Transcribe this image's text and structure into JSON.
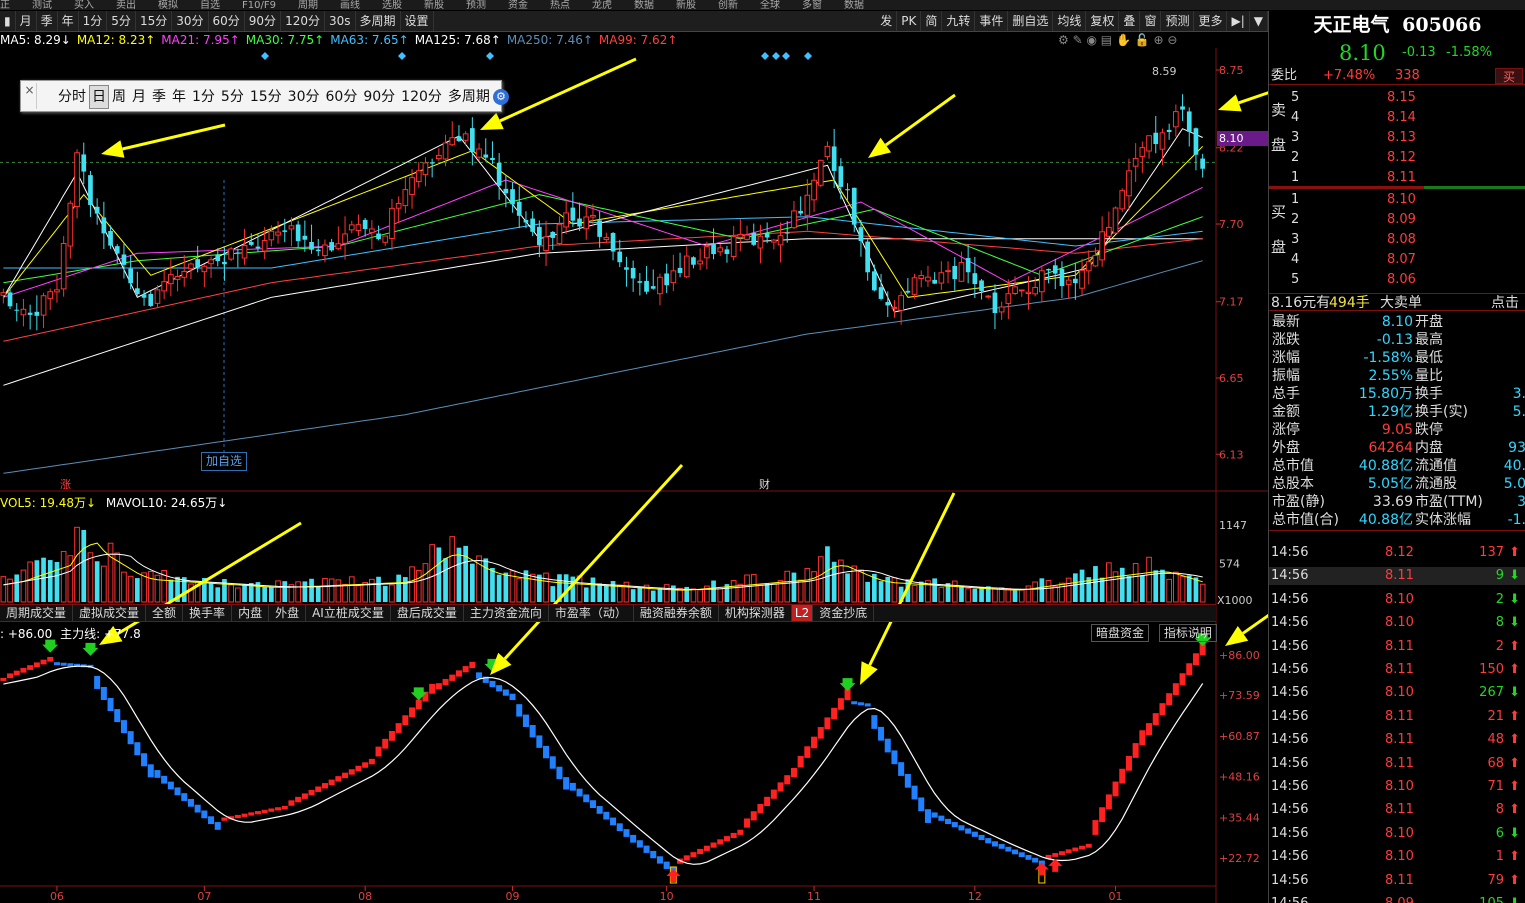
{
  "top_menu": [
    "正",
    "测试",
    "买入",
    "卖出",
    "模拟",
    "自选",
    "F10/F9",
    "周期",
    "画线",
    "选股",
    "新股",
    "预测",
    "资金",
    "热点",
    "龙虎",
    "数据",
    "新股",
    "创新",
    "全球",
    "多窗",
    "数据"
  ],
  "toolbar": {
    "periods": [
      "月",
      "季",
      "年",
      "1分",
      "5分",
      "15分",
      "30分",
      "60分",
      "90分",
      "120分",
      "30s",
      "多周期",
      "设置"
    ],
    "right_items": [
      "发",
      "PK",
      "简",
      "九转",
      "事件",
      "删自选",
      "均线",
      "复权",
      "叠",
      "窗",
      "预测",
      "更多"
    ]
  },
  "ma_legend": [
    {
      "label": "MA5: 8.29↓",
      "color": "#ffffff"
    },
    {
      "label": "MA12: 8.23↑",
      "color": "#ffff00"
    },
    {
      "label": "MA21: 7.95↑",
      "color": "#ff40ff"
    },
    {
      "label": "MA30: 7.75↑",
      "color": "#40ff40"
    },
    {
      "label": "MA63: 7.65↑",
      "color": "#40c0ff"
    },
    {
      "label": "MA125: 7.68↑",
      "color": "#ffffff"
    },
    {
      "label": "MA250: 7.46↑",
      "color": "#5a8fb8"
    },
    {
      "label": "MA99: 7.62↑",
      "color": "#ff4040"
    }
  ],
  "period_popup": {
    "items": [
      "分时",
      "日",
      "周",
      "月",
      "季",
      "年",
      "1分",
      "5分",
      "15分",
      "30分",
      "60分",
      "90分",
      "120分",
      "多周期"
    ],
    "selected": "日",
    "close_symbol": "×"
  },
  "price_axis": [
    "8.75",
    "8.22",
    "7.70",
    "7.17",
    "6.65",
    "6.13"
  ],
  "current_price_tag": "8.10",
  "high_marker": "8.59",
  "add_favorite_tag": "加自选",
  "event_markers": [
    {
      "text": "涨"
    },
    {
      "text": "财"
    }
  ],
  "volume_legend": {
    "vol5": "VOL5: 19.48万↓",
    "mavol10": "MAVOL10: 24.65万↓"
  },
  "volume_axis": [
    "1147",
    "574",
    "X1000"
  ],
  "indicator_tabs": [
    "周期成交量",
    "虚拟成交量",
    "全额",
    "换手率",
    "内盘",
    "外盘",
    "AI立桩成交量",
    "盘后成交量",
    "主力资金流向",
    "市盈率（动）",
    "融资融券余额",
    "机构探测器",
    "L2",
    "资金抄底"
  ],
  "indicator_legend": {
    "value": ": +86.00",
    "mainline": "主力线: +77.8"
  },
  "indicator_buttons": [
    "暗盘资金",
    "指标说明"
  ],
  "indicator_axis": [
    "+86.00",
    "+73.59",
    "+60.87",
    "+48.16",
    "+35.44",
    "+22.72"
  ],
  "date_axis": [
    "06",
    "07",
    "08",
    "09",
    "10",
    "11",
    "12",
    "01"
  ],
  "quote": {
    "name": "天正电气",
    "code": "605066",
    "price": "8.10",
    "change": "-0.13",
    "change_pct": "-1.58%",
    "commission_label": "委比",
    "commission_ratio": "+7.48%",
    "commission_diff": "338",
    "sell_button": "买",
    "sell_side_label": "卖盘",
    "buy_side_label": "买盘",
    "asks": [
      {
        "level": "5",
        "price": "8.15",
        "vol": ""
      },
      {
        "level": "4",
        "price": "8.14",
        "vol": ""
      },
      {
        "level": "3",
        "price": "8.13",
        "vol": ""
      },
      {
        "level": "2",
        "price": "8.12",
        "vol": ""
      },
      {
        "level": "1",
        "price": "8.11",
        "vol": ""
      }
    ],
    "bids": [
      {
        "level": "1",
        "price": "8.10",
        "vol": ""
      },
      {
        "level": "2",
        "price": "8.09",
        "vol": ""
      },
      {
        "level": "3",
        "price": "8.08",
        "vol": ""
      },
      {
        "level": "4",
        "price": "8.07",
        "vol": ""
      },
      {
        "level": "5",
        "price": "8.06",
        "vol": ""
      }
    ],
    "big_order": {
      "price": "8.16元有",
      "hands": "494手",
      "label": "大卖单",
      "link": "点击"
    },
    "stats": [
      {
        "k": "最新",
        "v": "8.10",
        "vc": "cyan",
        "k2": "开盘",
        "v2": ""
      },
      {
        "k": "涨跌",
        "v": "-0.13",
        "vc": "cyan",
        "k2": "最高",
        "v2": ""
      },
      {
        "k": "涨幅",
        "v": "-1.58%",
        "vc": "cyan",
        "k2": "最低",
        "v2": ""
      },
      {
        "k": "振幅",
        "v": "2.55%",
        "vc": "cyan",
        "k2": "量比",
        "v2": ""
      },
      {
        "k": "总手",
        "v": "15.80万",
        "vc": "cyan",
        "k2": "换手",
        "v2": "3."
      },
      {
        "k": "金额",
        "v": "1.29亿",
        "vc": "cyan",
        "k2": "换手(实)",
        "v2": "5."
      },
      {
        "k": "涨停",
        "v": "9.05",
        "vc": "red",
        "k2": "跌停",
        "v2": ""
      },
      {
        "k": "外盘",
        "v": "64264",
        "vc": "red",
        "k2": "内盘",
        "v2": "93"
      },
      {
        "k": "总市值",
        "v": "40.88亿",
        "vc": "cyan",
        "k2": "流通值",
        "v2": "40."
      },
      {
        "k": "总股本",
        "v": "5.05亿",
        "vc": "cyan",
        "k2": "流通股",
        "v2": "5.0"
      },
      {
        "k": "市盈(静)",
        "v": "33.69",
        "vc": "white",
        "k2": "市盈(TTM)",
        "v2": "3"
      },
      {
        "k": "总市值(合)",
        "v": "40.88亿",
        "vc": "cyan",
        "k2": "实体涨幅",
        "v2": "-1."
      }
    ],
    "ticks": [
      {
        "t": "14:56",
        "p": "8.12",
        "v": "137",
        "d": "up"
      },
      {
        "t": "14:56",
        "p": "8.11",
        "v": "9",
        "d": "down"
      },
      {
        "t": "14:56",
        "p": "8.10",
        "v": "2",
        "d": "down"
      },
      {
        "t": "14:56",
        "p": "8.10",
        "v": "8",
        "d": "down"
      },
      {
        "t": "14:56",
        "p": "8.11",
        "v": "2",
        "d": "up"
      },
      {
        "t": "14:56",
        "p": "8.11",
        "v": "150",
        "d": "up"
      },
      {
        "t": "14:56",
        "p": "8.10",
        "v": "267",
        "d": "down"
      },
      {
        "t": "14:56",
        "p": "8.11",
        "v": "21",
        "d": "up"
      },
      {
        "t": "14:56",
        "p": "8.11",
        "v": "48",
        "d": "up"
      },
      {
        "t": "14:56",
        "p": "8.11",
        "v": "68",
        "d": "up"
      },
      {
        "t": "14:56",
        "p": "8.10",
        "v": "71",
        "d": "up"
      },
      {
        "t": "14:56",
        "p": "8.11",
        "v": "8",
        "d": "up"
      },
      {
        "t": "14:56",
        "p": "8.10",
        "v": "6",
        "d": "down"
      },
      {
        "t": "14:56",
        "p": "8.10",
        "v": "1",
        "d": "up"
      },
      {
        "t": "14:56",
        "p": "8.11",
        "v": "79",
        "d": "up"
      },
      {
        "t": "14:56",
        "p": "8.09",
        "v": "105",
        "d": "down"
      }
    ]
  },
  "chart_data": [
    {
      "type": "candlestick",
      "title": "",
      "ylim": [
        5.9,
        8.9
      ],
      "x_ticks": [
        "06",
        "07",
        "08",
        "09",
        "10",
        "11",
        "12",
        "01"
      ],
      "price_anchors": [
        {
          "i": 0,
          "p": 7.2
        },
        {
          "i": 5,
          "p": 7.1
        },
        {
          "i": 8,
          "p": 7.3
        },
        {
          "i": 11,
          "p": 8.2
        },
        {
          "i": 13,
          "p": 7.85
        },
        {
          "i": 18,
          "p": 7.4
        },
        {
          "i": 22,
          "p": 7.15
        },
        {
          "i": 26,
          "p": 7.35
        },
        {
          "i": 30,
          "p": 7.45
        },
        {
          "i": 36,
          "p": 7.5
        },
        {
          "i": 42,
          "p": 7.65
        },
        {
          "i": 48,
          "p": 7.55
        },
        {
          "i": 52,
          "p": 7.65
        },
        {
          "i": 56,
          "p": 7.6
        },
        {
          "i": 60,
          "p": 7.9
        },
        {
          "i": 64,
          "p": 8.15
        },
        {
          "i": 68,
          "p": 8.3
        },
        {
          "i": 72,
          "p": 8.2
        },
        {
          "i": 76,
          "p": 7.8
        },
        {
          "i": 80,
          "p": 7.55
        },
        {
          "i": 84,
          "p": 7.75
        },
        {
          "i": 88,
          "p": 7.7
        },
        {
          "i": 92,
          "p": 7.45
        },
        {
          "i": 96,
          "p": 7.25
        },
        {
          "i": 100,
          "p": 7.35
        },
        {
          "i": 104,
          "p": 7.5
        },
        {
          "i": 108,
          "p": 7.55
        },
        {
          "i": 112,
          "p": 7.6
        },
        {
          "i": 116,
          "p": 7.62
        },
        {
          "i": 120,
          "p": 7.9
        },
        {
          "i": 123,
          "p": 8.2
        },
        {
          "i": 126,
          "p": 7.9
        },
        {
          "i": 129,
          "p": 7.4
        },
        {
          "i": 132,
          "p": 7.1
        },
        {
          "i": 136,
          "p": 7.3
        },
        {
          "i": 140,
          "p": 7.35
        },
        {
          "i": 144,
          "p": 7.4
        },
        {
          "i": 148,
          "p": 7.1
        },
        {
          "i": 152,
          "p": 7.25
        },
        {
          "i": 156,
          "p": 7.35
        },
        {
          "i": 160,
          "p": 7.3
        },
        {
          "i": 164,
          "p": 7.6
        },
        {
          "i": 168,
          "p": 8.1
        },
        {
          "i": 172,
          "p": 8.3
        },
        {
          "i": 176,
          "p": 8.45
        },
        {
          "i": 179,
          "p": 8.1
        }
      ],
      "ma_lines": [
        {
          "name": "MA125",
          "color": "#ffffff",
          "anchors": [
            {
              "i": 0,
              "p": 6.6
            },
            {
              "i": 40,
              "p": 7.2
            },
            {
              "i": 80,
              "p": 7.5
            },
            {
              "i": 120,
              "p": 7.6
            },
            {
              "i": 179,
              "p": 7.6
            }
          ]
        },
        {
          "name": "MA250",
          "color": "#5a8fb8",
          "anchors": [
            {
              "i": 0,
              "p": 6.0
            },
            {
              "i": 60,
              "p": 6.4
            },
            {
              "i": 120,
              "p": 6.95
            },
            {
              "i": 160,
              "p": 7.2
            },
            {
              "i": 179,
              "p": 7.45
            }
          ]
        },
        {
          "name": "MA99",
          "color": "#ff4040",
          "anchors": [
            {
              "i": 0,
              "p": 6.9
            },
            {
              "i": 40,
              "p": 7.3
            },
            {
              "i": 80,
              "p": 7.55
            },
            {
              "i": 120,
              "p": 7.65
            },
            {
              "i": 160,
              "p": 7.5
            },
            {
              "i": 179,
              "p": 7.6
            }
          ]
        },
        {
          "name": "MA63",
          "color": "#40c0ff",
          "anchors": [
            {
              "i": 0,
              "p": 7.4
            },
            {
              "i": 40,
              "p": 7.4
            },
            {
              "i": 80,
              "p": 7.7
            },
            {
              "i": 120,
              "p": 7.75
            },
            {
              "i": 160,
              "p": 7.55
            },
            {
              "i": 179,
              "p": 7.65
            }
          ]
        },
        {
          "name": "MA30",
          "color": "#40ff40",
          "anchors": [
            {
              "i": 0,
              "p": 7.3
            },
            {
              "i": 20,
              "p": 7.45
            },
            {
              "i": 50,
              "p": 7.55
            },
            {
              "i": 80,
              "p": 7.9
            },
            {
              "i": 110,
              "p": 7.6
            },
            {
              "i": 130,
              "p": 7.8
            },
            {
              "i": 155,
              "p": 7.35
            },
            {
              "i": 179,
              "p": 7.75
            }
          ]
        },
        {
          "name": "MA21",
          "color": "#ff40ff",
          "anchors": [
            {
              "i": 0,
              "p": 7.2
            },
            {
              "i": 20,
              "p": 7.5
            },
            {
              "i": 50,
              "p": 7.55
            },
            {
              "i": 75,
              "p": 8.0
            },
            {
              "i": 105,
              "p": 7.55
            },
            {
              "i": 128,
              "p": 7.85
            },
            {
              "i": 150,
              "p": 7.3
            },
            {
              "i": 179,
              "p": 7.95
            }
          ]
        },
        {
          "name": "MA12",
          "color": "#ffff00",
          "anchors": [
            {
              "i": 0,
              "p": 7.2
            },
            {
              "i": 12,
              "p": 7.9
            },
            {
              "i": 22,
              "p": 7.35
            },
            {
              "i": 70,
              "p": 8.2
            },
            {
              "i": 85,
              "p": 7.7
            },
            {
              "i": 124,
              "p": 8.0
            },
            {
              "i": 135,
              "p": 7.2
            },
            {
              "i": 160,
              "p": 7.35
            },
            {
              "i": 179,
              "p": 8.23
            }
          ]
        },
        {
          "name": "MA5",
          "color": "#ffffff",
          "anchors": [
            {
              "i": 0,
              "p": 7.2
            },
            {
              "i": 11,
              "p": 8.05
            },
            {
              "i": 20,
              "p": 7.2
            },
            {
              "i": 68,
              "p": 8.3
            },
            {
              "i": 80,
              "p": 7.6
            },
            {
              "i": 123,
              "p": 8.1
            },
            {
              "i": 133,
              "p": 7.1
            },
            {
              "i": 162,
              "p": 7.4
            },
            {
              "i": 176,
              "p": 8.35
            },
            {
              "i": 179,
              "p": 8.29
            }
          ]
        }
      ]
    },
    {
      "type": "bar",
      "title": "VOL",
      "ylim": [
        0,
        1400
      ],
      "volume_anchors": [
        {
          "i": 0,
          "v": 300
        },
        {
          "i": 10,
          "v": 700
        },
        {
          "i": 11,
          "v": 1300
        },
        {
          "i": 13,
          "v": 900
        },
        {
          "i": 20,
          "v": 400
        },
        {
          "i": 40,
          "v": 250
        },
        {
          "i": 60,
          "v": 350
        },
        {
          "i": 66,
          "v": 900
        },
        {
          "i": 72,
          "v": 500
        },
        {
          "i": 80,
          "v": 350
        },
        {
          "i": 100,
          "v": 200
        },
        {
          "i": 120,
          "v": 400
        },
        {
          "i": 123,
          "v": 700
        },
        {
          "i": 130,
          "v": 350
        },
        {
          "i": 150,
          "v": 200
        },
        {
          "i": 165,
          "v": 450
        },
        {
          "i": 172,
          "v": 550
        },
        {
          "i": 179,
          "v": 300
        }
      ]
    },
    {
      "type": "step",
      "title": "主力线",
      "ylim": [
        15,
        92
      ],
      "x_ticks": [
        "06",
        "07",
        "08",
        "09",
        "10",
        "11",
        "12",
        "01"
      ],
      "anchors": [
        {
          "i": 0,
          "v": 78
        },
        {
          "i": 7,
          "v": 84
        },
        {
          "i": 13,
          "v": 83
        },
        {
          "i": 22,
          "v": 52
        },
        {
          "i": 32,
          "v": 34
        },
        {
          "i": 42,
          "v": 38
        },
        {
          "i": 55,
          "v": 52
        },
        {
          "i": 64,
          "v": 74
        },
        {
          "i": 70,
          "v": 82
        },
        {
          "i": 76,
          "v": 74
        },
        {
          "i": 84,
          "v": 48
        },
        {
          "i": 94,
          "v": 30
        },
        {
          "i": 100,
          "v": 20
        },
        {
          "i": 110,
          "v": 30
        },
        {
          "i": 118,
          "v": 48
        },
        {
          "i": 126,
          "v": 72
        },
        {
          "i": 129,
          "v": 71
        },
        {
          "i": 138,
          "v": 38
        },
        {
          "i": 148,
          "v": 28
        },
        {
          "i": 155,
          "v": 22
        },
        {
          "i": 162,
          "v": 26
        },
        {
          "i": 170,
          "v": 58
        },
        {
          "i": 179,
          "v": 86
        }
      ]
    }
  ]
}
